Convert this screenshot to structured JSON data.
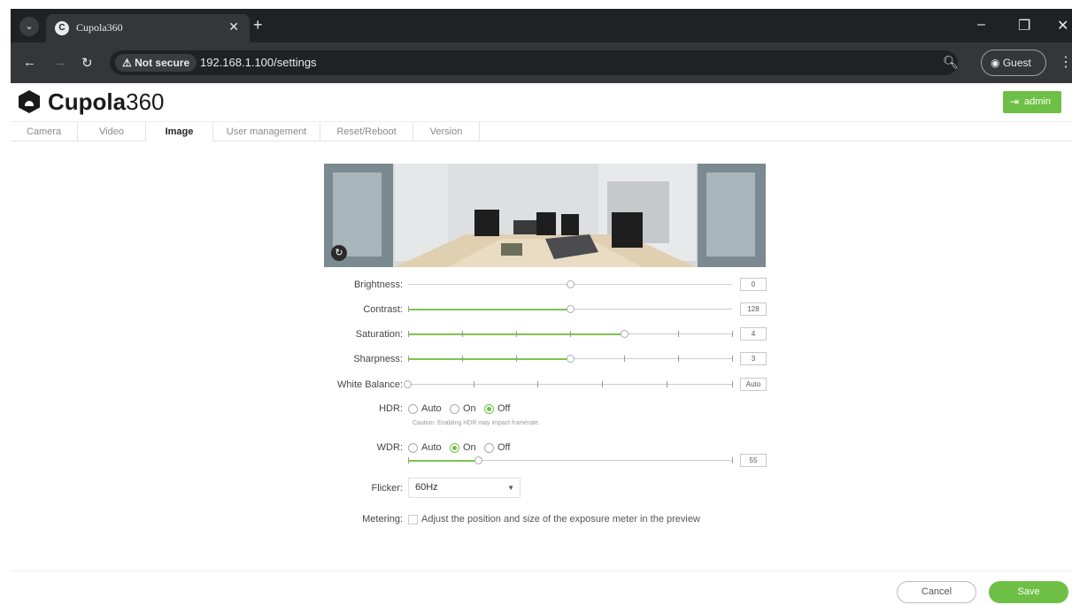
{
  "browser": {
    "tab_title": "Cupola360",
    "tab_favicon": "C",
    "not_secure": "Not secure",
    "url": "192.168.1.100/settings",
    "profile": "Guest"
  },
  "app": {
    "logo_bold": "Cupola",
    "logo_number": "360",
    "user_button": "admin",
    "accent_color": "#6dc045"
  },
  "tabs": [
    {
      "label": "Camera"
    },
    {
      "label": "Video"
    },
    {
      "label": "Image"
    },
    {
      "label": "User management"
    },
    {
      "label": "Reset/Reboot"
    },
    {
      "label": "Version"
    }
  ],
  "active_tab": "Image",
  "settings": {
    "brightness": {
      "label": "Brightness:",
      "value": "0"
    },
    "contrast": {
      "label": "Contrast:",
      "value": "128"
    },
    "saturation": {
      "label": "Saturation:",
      "value": "4"
    },
    "sharpness": {
      "label": "Sharpness:",
      "value": "3"
    },
    "white_balance": {
      "label": "White Balance:",
      "value": "Auto"
    },
    "hdr": {
      "label": "HDR:",
      "options": [
        "Auto",
        "On",
        "Off"
      ],
      "selected": "Off",
      "caution": "Caution: Enabling HDR may impact framerate."
    },
    "wdr": {
      "label": "WDR:",
      "options": [
        "Auto",
        "On",
        "Off"
      ],
      "selected": "On",
      "value": "55"
    },
    "flicker": {
      "label": "Flicker:",
      "value": "60Hz"
    },
    "metering": {
      "label": "Metering:",
      "text": "Adjust the position and size of the exposure meter in the preview"
    }
  },
  "footer": {
    "cancel": "Cancel",
    "save": "Save"
  }
}
